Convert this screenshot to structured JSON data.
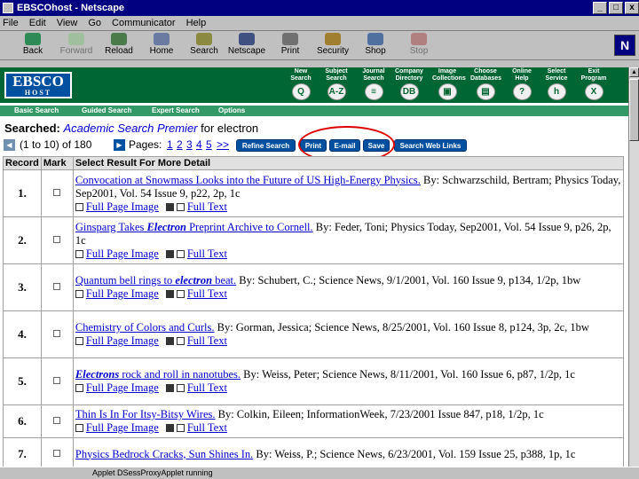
{
  "window": {
    "title": "EBSCOhost - Netscape",
    "controls": [
      "_",
      "□",
      "x"
    ]
  },
  "menu": [
    "File",
    "Edit",
    "View",
    "Go",
    "Communicator",
    "Help"
  ],
  "toolbar": {
    "buttons": [
      {
        "label": "Back",
        "icon": "back-arrow-icon"
      },
      {
        "label": "Forward",
        "icon": "forward-arrow-icon"
      },
      {
        "label": "Reload",
        "icon": "reload-icon"
      },
      {
        "label": "Home",
        "icon": "home-icon"
      },
      {
        "label": "Search",
        "icon": "search-icon"
      },
      {
        "label": "Netscape",
        "icon": "netscape-icon"
      },
      {
        "label": "Print",
        "icon": "printer-icon"
      },
      {
        "label": "Security",
        "icon": "lock-icon"
      },
      {
        "label": "Shop",
        "icon": "shop-icon"
      },
      {
        "label": "Stop",
        "icon": "stop-icon"
      }
    ],
    "logo": "N"
  },
  "ebsco": {
    "logo_line1": "EBSCO",
    "logo_line2": "HOST",
    "header_nav": [
      {
        "label": "New Search",
        "glyph": "Q"
      },
      {
        "label": "Subject Search",
        "glyph": "A-Z"
      },
      {
        "label": "Journal Search",
        "glyph": "≡"
      },
      {
        "label": "Company Directory",
        "glyph": "DB"
      },
      {
        "label": "Image Collections",
        "glyph": "▣"
      },
      {
        "label": "Choose Databases",
        "glyph": "▤"
      },
      {
        "label": "Online Help",
        "glyph": "?"
      },
      {
        "label": "Select Service",
        "glyph": "h"
      },
      {
        "label": "Exit Program",
        "glyph": "X"
      }
    ],
    "subnav": [
      "Basic Search",
      "Guided Search",
      "Expert Search",
      "Options"
    ]
  },
  "search": {
    "searched_label": "Searched:",
    "database": "Academic Search Premier",
    "for_text": "for electron"
  },
  "pagination": {
    "range": "(1 to 10) of 180",
    "pages_label": "Pages:",
    "pages": [
      "1",
      "2",
      "3",
      "4",
      "5",
      ">>"
    ]
  },
  "actions": [
    "Refine Search",
    "Print",
    "E-mail",
    "Save",
    "Search Web Links"
  ],
  "table": {
    "headers": [
      "Record",
      "Mark",
      "Select Result For More Detail"
    ],
    "full_page_image": "Full Page Image",
    "full_text": "Full Text",
    "rows": [
      {
        "num": "1.",
        "title": "Convocation at Snowmass Looks into the Future of US High-Energy Physics.",
        "rest": " By: Schwarzschild, Bertram; Physics Today, Sep2001, Vol. 54 Issue 9, p22, 2p, 1c",
        "fpi": true
      },
      {
        "num": "2.",
        "title_pre": "Ginsparg Takes ",
        "title_em": "Electron",
        "title_post": " Preprint Archive to Cornell.",
        "rest": " By: Feder, Toni; Physics Today, Sep2001, Vol. 54 Issue 9, p26, 2p, 1c",
        "fpi": true
      },
      {
        "num": "3.",
        "title_pre": "Quantum bell rings to ",
        "title_em": "electron",
        "title_post": " beat.",
        "rest": " By: Schubert, C.; Science News, 9/1/2001, Vol. 160 Issue 9, p134, 1/2p, 1bw",
        "fpi": true
      },
      {
        "num": "4.",
        "title": "Chemistry of Colors and Curls.",
        "rest": " By: Gorman, Jessica; Science News, 8/25/2001, Vol. 160 Issue 8, p124, 3p, 2c, 1bw",
        "fpi": true
      },
      {
        "num": "5.",
        "title_pre": "",
        "title_em": "Electrons",
        "title_post": " rock and roll in nanotubes.",
        "rest": " By: Weiss, Peter; Science News, 8/11/2001, Vol. 160 Issue 6, p87, 1/2p, 1c",
        "fpi": true
      },
      {
        "num": "6.",
        "title": "Thin Is In For Itsy-Bitsy Wires.",
        "rest": " By: Colkin, Eileen; InformationWeek, 7/23/2001 Issue 847, p18, 1/2p, 1c",
        "fpi": true
      },
      {
        "num": "7.",
        "title": "Physics Bedrock Cracks, Sun Shines In.",
        "rest": " By: Weiss, P.; Science News, 6/23/2001, Vol. 159 Issue 25, p388, 1p, 1c",
        "fpi": false
      }
    ]
  },
  "status": {
    "text": "Applet DSessProxyApplet running"
  },
  "colors": {
    "ebsco_green": "#006633",
    "subnav_green": "#339966",
    "button_blue": "#0050a0",
    "link_blue": "#0000cc",
    "highlight_red": "#dd0000",
    "titlebar_navy": "#000080"
  }
}
